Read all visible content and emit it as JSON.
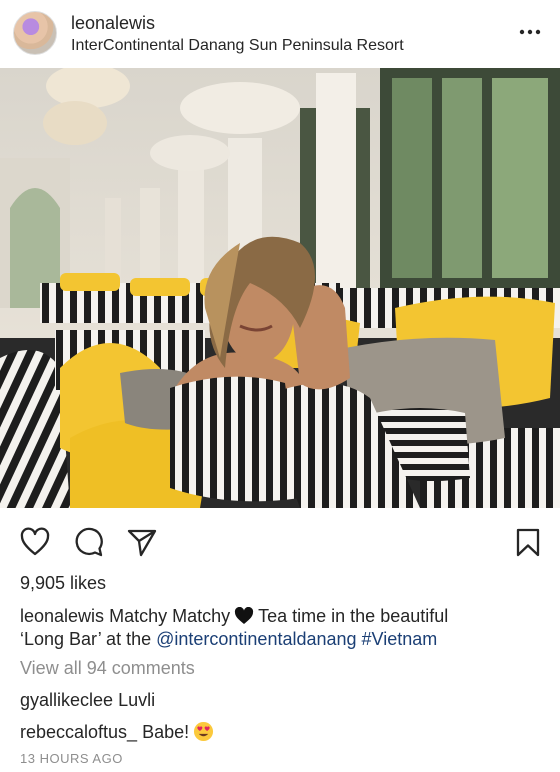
{
  "post": {
    "username": "leonalewis",
    "location": "InterContinental Danang Sun Peninsula Resort",
    "likes": "9,905 likes",
    "caption": {
      "author": "leonalewis",
      "text_before_emoji": "Matchy Matchy",
      "text_after_emoji": "Tea time in the beautiful",
      "text_line2": "‘Long Bar’ at the",
      "mention": "@intercontinentaldanang",
      "hashtag": "#Vietnam"
    },
    "view_all_comments": "View all 94 comments",
    "comments": [
      {
        "author": "gyallikeclee",
        "text": "Luvli"
      },
      {
        "author": "rebeccaloftus_",
        "text": "Babe!"
      }
    ],
    "timestamp": "13 HOURS AGO"
  },
  "icons": {
    "more": "more-options-icon",
    "like": "heart-outline-icon",
    "comment": "speech-bubble-icon",
    "share": "paper-plane-icon",
    "save": "bookmark-outline-icon",
    "emoji_heart": "black-heart-emoji",
    "emoji_face": "heart-eyes-emoji"
  },
  "colors": {
    "text": "#262626",
    "link": "#1b3f75",
    "muted": "#8e8e8e",
    "accent_yellow": "#f3c531"
  }
}
